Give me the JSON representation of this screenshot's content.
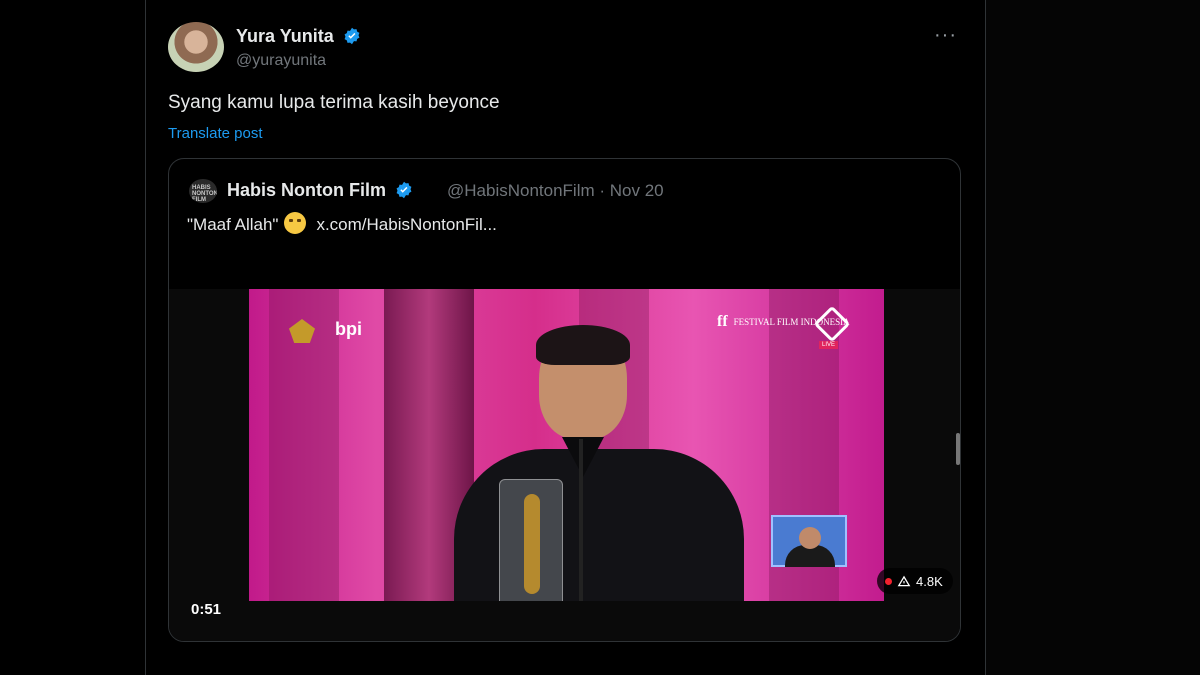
{
  "post": {
    "author_name": "Yura Yunita",
    "handle": "@yurayunita",
    "text": "Syang kamu lupa terima kasih beyonce",
    "translate_label": "Translate post",
    "more_label": "···"
  },
  "quote": {
    "author_name": "Habis Nonton Film",
    "avatar_label": "HABIS NONTON FILM",
    "handle_date": "@HabisNontonFilm · Nov 20",
    "text": "\"Maaf Allah\"",
    "link": "x.com/HabisNontonFil...",
    "emoji": "loudly-crying-face"
  },
  "video": {
    "time": "0:51",
    "views": "4.8K",
    "overlay_logos": {
      "bpi": "bpi",
      "festival": "FESTIVAL FILM INDONESIA",
      "live": "LIVE"
    }
  },
  "colors": {
    "background": "#000000",
    "accent": "#1d9bf0",
    "text_primary": "#e7e9ea",
    "text_secondary": "#71767b",
    "border": "#2f3336"
  },
  "icons": [
    "verified-badge-icon",
    "more-options-icon",
    "views-icon"
  ]
}
